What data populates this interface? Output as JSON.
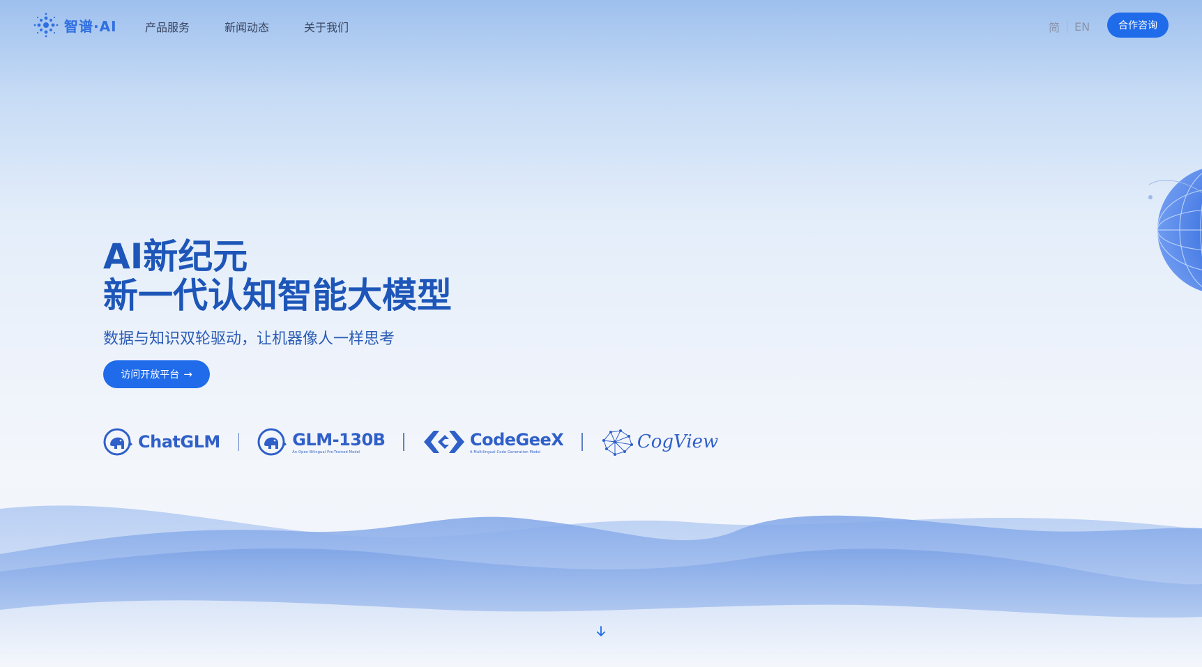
{
  "brand": {
    "name": "智谱·AI",
    "accent": "#1f6bea"
  },
  "nav": {
    "items": [
      {
        "label": "产品服务"
      },
      {
        "label": "新闻动态"
      },
      {
        "label": "关于我们"
      }
    ]
  },
  "lang": {
    "zh": "简",
    "en": "EN"
  },
  "header": {
    "contact_label": "合作咨询"
  },
  "hero": {
    "title_line1": "AI新纪元",
    "title_line2": "新一代认知智能大模型",
    "subtitle": "数据与知识双轮驱动，让机器像人一样思考",
    "cta_label": "访问开放平台"
  },
  "products": [
    {
      "name": "ChatGLM"
    },
    {
      "name": "GLM-130B",
      "tagline": "An Open Bilingual Pre-Trained Model"
    },
    {
      "name": "CodeGeeX",
      "tagline": "A Multilingual Code Generation Model"
    },
    {
      "name": "CogView"
    }
  ]
}
